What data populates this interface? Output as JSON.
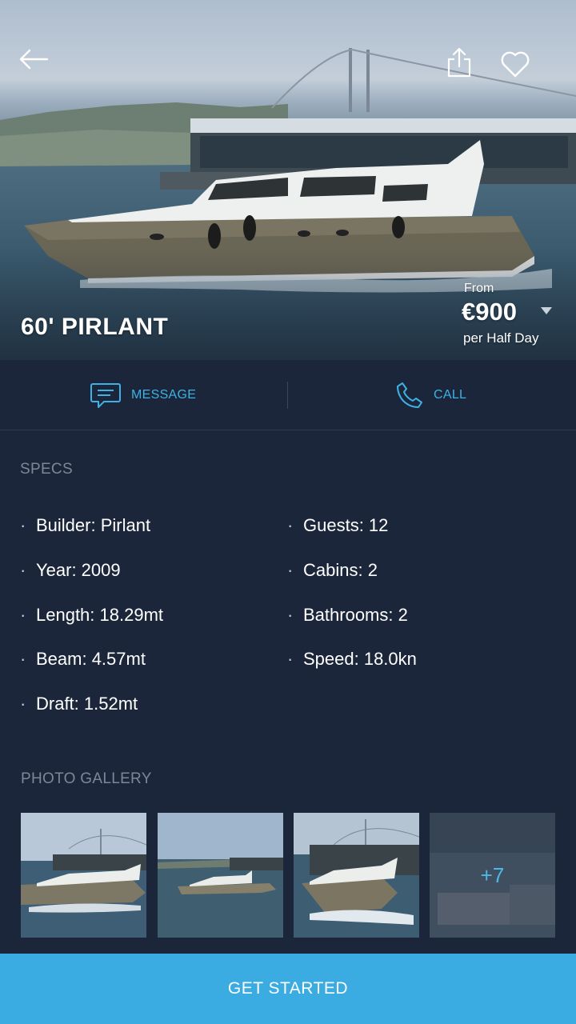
{
  "hero": {
    "title": "60' PIRLANT",
    "price_prefix": "From",
    "price": "€900",
    "price_unit": "per Half Day",
    "icons": [
      "back-arrow-icon",
      "share-icon",
      "heart-icon",
      "price-dropdown-caret-icon"
    ]
  },
  "actions": {
    "message_label": "MESSAGE",
    "call_label": "CALL",
    "icons": [
      "message-icon",
      "phone-icon"
    ]
  },
  "specs": {
    "title": "SPECS",
    "left": [
      "Builder: Pirlant",
      "Year: 2009",
      "Length: 18.29mt",
      "Beam: 4.57mt",
      "Draft: 1.52mt"
    ],
    "right": [
      "Guests: 12",
      "Cabins: 2",
      "Bathrooms: 2",
      "Speed: 18.0kn"
    ],
    "bullet": "·"
  },
  "gallery": {
    "title": "PHOTO GALLERY",
    "more_label": "+7"
  },
  "cta": {
    "label": "GET STARTED"
  },
  "colors": {
    "background": "#1b263b",
    "accent": "#3aace2",
    "link": "#3fb1e4",
    "muted": "#7d8798"
  }
}
